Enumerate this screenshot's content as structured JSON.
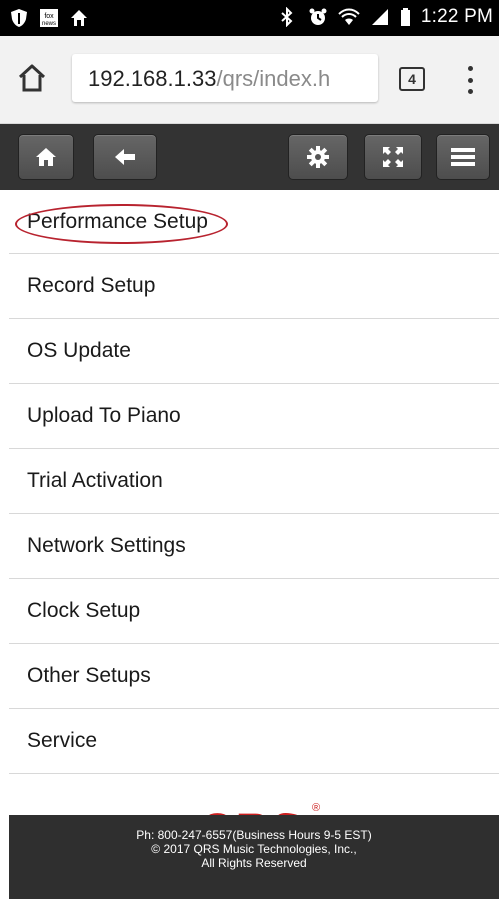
{
  "status_bar": {
    "time": "1:22 PM",
    "left_icons": [
      "shield-notification-icon",
      "fox-news-icon",
      "home-notification-icon"
    ],
    "right_icons": [
      "bluetooth-icon",
      "alarm-icon",
      "wifi-icon",
      "signal-icon",
      "battery-icon"
    ]
  },
  "browser": {
    "url_host": "192.168.1.33",
    "url_path": "/qrs/index.h",
    "tab_count": "4"
  },
  "toolbar": {
    "buttons": [
      "home",
      "back",
      "settings",
      "fullscreen",
      "menu"
    ]
  },
  "menu": {
    "items": [
      {
        "label": "Performance Setup",
        "highlighted": true
      },
      {
        "label": "Record Setup"
      },
      {
        "label": "OS Update"
      },
      {
        "label": "Upload To Piano"
      },
      {
        "label": "Trial Activation"
      },
      {
        "label": "Network Settings"
      },
      {
        "label": "Clock Setup"
      },
      {
        "label": "Other Setups"
      },
      {
        "label": "Service"
      }
    ]
  },
  "logo": {
    "text": "QRS",
    "mark": "®"
  },
  "footer": {
    "phone": "Ph: 800-247-6557(Business Hours 9-5 EST)",
    "copyright": "© 2017 QRS Music Technologies, Inc.,",
    "rights": "All Rights Reserved"
  },
  "colors": {
    "toolbar_bg": "#333333",
    "annotation": "#b8232f",
    "logo": "#cc1f1f"
  }
}
